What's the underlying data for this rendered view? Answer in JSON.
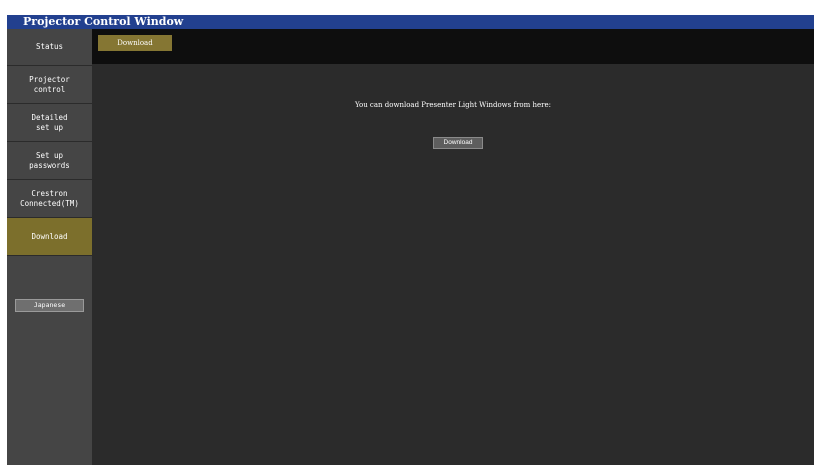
{
  "window": {
    "title": "Projector Control Window"
  },
  "sidebar": {
    "items": [
      {
        "label": "Status",
        "active": false
      },
      {
        "label": "Projector\ncontrol",
        "active": false
      },
      {
        "label": "Detailed\nset up",
        "active": false
      },
      {
        "label": "Set up\npasswords",
        "active": false
      },
      {
        "label": "Crestron\nConnected(TM)",
        "active": false
      },
      {
        "label": "Download",
        "active": true
      }
    ],
    "language_button": "Japanese"
  },
  "tabs": {
    "active_label": "Download"
  },
  "main": {
    "message": "You can download Presenter Light Windows from here:",
    "download_button": "Download"
  },
  "colors": {
    "title_bar": "#22408f",
    "sidebar": "#454545",
    "active": "#7c6f2c",
    "background": "#2b2b2b",
    "tab_bar": "#0e0e0e"
  }
}
